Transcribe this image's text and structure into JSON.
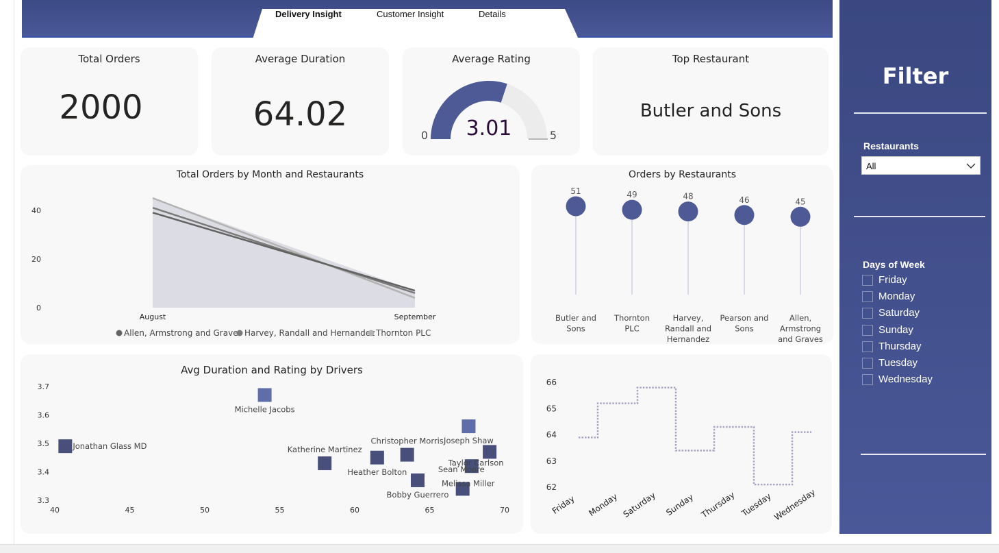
{
  "tabs": [
    {
      "label": "Delivery Insight",
      "active": true
    },
    {
      "label": "Customer Insight",
      "active": false
    },
    {
      "label": "Details",
      "active": false
    }
  ],
  "kpis": {
    "total_orders": {
      "title": "Total Orders",
      "value": "2000"
    },
    "avg_duration": {
      "title": "Average Duration",
      "value": "64.02"
    },
    "avg_rating": {
      "title": "Average Rating",
      "value": "3.01",
      "min": "0",
      "max": "5",
      "fraction": 0.602
    },
    "top_restaurant": {
      "title": "Top Restaurant",
      "value": "Butler and Sons"
    }
  },
  "filter": {
    "title": "Filter",
    "restaurants_label": "Restaurants",
    "restaurants_selected": "All",
    "days_label": "Days of Week",
    "days": [
      "Friday",
      "Monday",
      "Saturday",
      "Sunday",
      "Thursday",
      "Tuesday",
      "Wednesday"
    ]
  },
  "colors": {
    "brand": "#4a5899",
    "accent": "#4e5a95",
    "marker_light": "#5f6ea8",
    "marker_dark": "#474f7a"
  },
  "chart_data": [
    {
      "id": "area",
      "type": "area",
      "title": "Total Orders by Month and Restaurants",
      "categories": [
        "August",
        "September"
      ],
      "yticks": [
        0,
        20,
        40
      ],
      "ylim": [
        0,
        45
      ],
      "series": [
        {
          "name": "Allen, Armstrong and Graves",
          "values": [
            39,
            7
          ],
          "color": "#636363"
        },
        {
          "name": "Harvey, Randall and Hernandez",
          "values": [
            41,
            6
          ],
          "color": "#7a7a7a"
        },
        {
          "name": "Thornton PLC",
          "values": [
            45,
            4
          ],
          "color": "#b3b3b3"
        }
      ]
    },
    {
      "id": "lollipop",
      "type": "bar",
      "title": "Orders by Restaurants",
      "categories": [
        "Butler and Sons",
        "Thornton PLC",
        "Harvey, Randall and Hernandez",
        "Pearson and Sons",
        "Allen, Armstrong and Graves"
      ],
      "category_lines": [
        [
          "Butler and",
          "Sons"
        ],
        [
          "Thornton",
          "PLC"
        ],
        [
          "Harvey,",
          "Randall and",
          "Hernandez"
        ],
        [
          "Pearson and",
          "Sons"
        ],
        [
          "Allen,",
          "Armstrong",
          "and Graves"
        ]
      ],
      "values": [
        51,
        49,
        48,
        46,
        45
      ]
    },
    {
      "id": "scatter",
      "type": "scatter",
      "title": "Avg Duration and Rating by Drivers",
      "xticks": [
        40,
        45,
        50,
        55,
        60,
        65,
        70
      ],
      "yticks": [
        3.3,
        3.4,
        3.5,
        3.6,
        3.7
      ],
      "xlim": [
        40,
        70
      ],
      "ylim": [
        3.3,
        3.7
      ],
      "points": [
        {
          "label": "Michelle Jacobs",
          "x": 54,
          "y": 3.67,
          "light": true
        },
        {
          "label": "Jonathan Glass MD",
          "x": 40.7,
          "y": 3.49,
          "light": false
        },
        {
          "label": "Joseph Shaw",
          "x": 67.6,
          "y": 3.56,
          "light": true
        },
        {
          "label": "Christopher Morris",
          "x": 63.5,
          "y": 3.46,
          "light": false
        },
        {
          "label": "Katherine Martinez",
          "x": 58,
          "y": 3.43,
          "light": false
        },
        {
          "label": "Heather Bolton",
          "x": 61.5,
          "y": 3.45,
          "light": false
        },
        {
          "label": "Taylor Carlson",
          "x": 69,
          "y": 3.47,
          "light": false
        },
        {
          "label": "Sean Moore",
          "x": 67.8,
          "y": 3.42,
          "light": false
        },
        {
          "label": "Melissa Miller",
          "x": 67.2,
          "y": 3.34,
          "light": false
        },
        {
          "label": "Bobby Guerrero",
          "x": 64.2,
          "y": 3.37,
          "light": false
        }
      ]
    },
    {
      "id": "step",
      "type": "line",
      "title": "",
      "categories": [
        "Friday",
        "Monday",
        "Saturday",
        "Sunday",
        "Thursday",
        "Tuesday",
        "Wednesday"
      ],
      "values": [
        63.9,
        65.2,
        65.8,
        63.4,
        64.3,
        62.1,
        64.1
      ],
      "yticks": [
        62,
        63,
        64,
        65,
        66
      ],
      "ylim": [
        61.7,
        66.2
      ]
    }
  ]
}
